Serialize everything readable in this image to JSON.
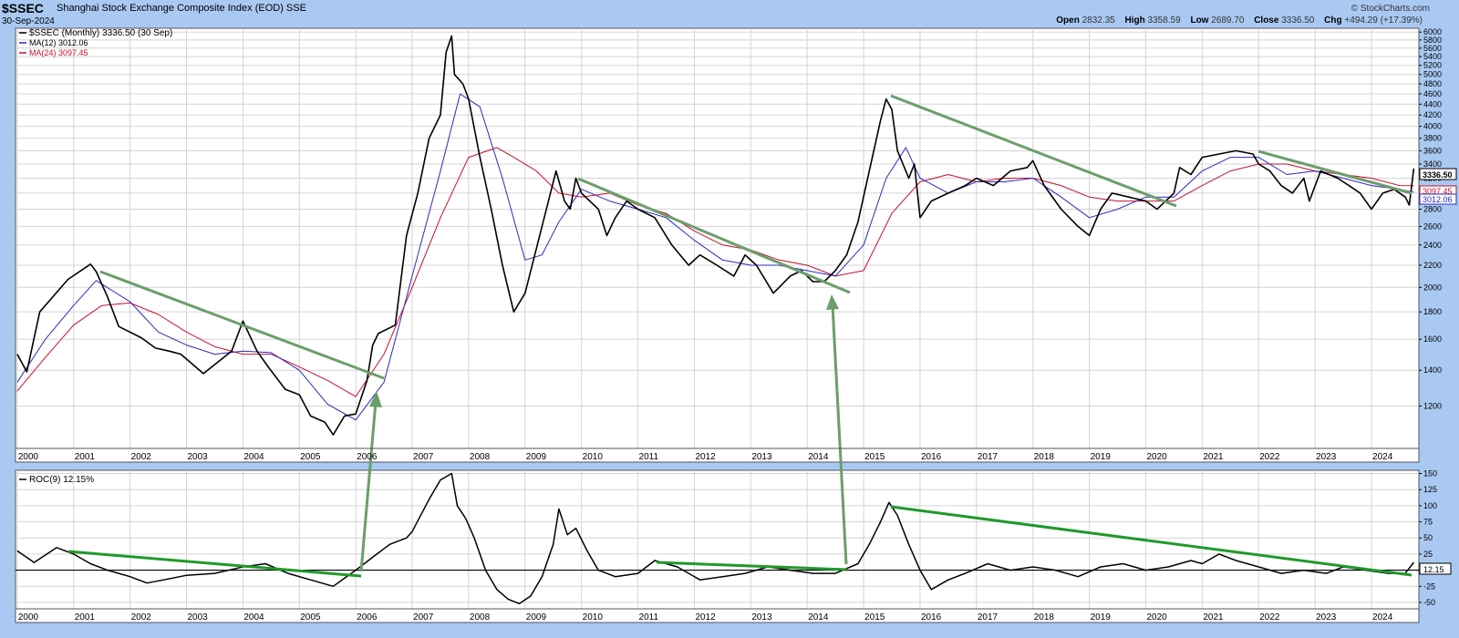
{
  "header": {
    "symbol": "$SSEC",
    "name": "Shanghai Stock Exchange Composite Index (EOD)  SSE",
    "date": "30-Sep-2024",
    "copyright": "© StockCharts.com",
    "open_label": "Open",
    "open_value": "2832.35",
    "high_label": "High",
    "high_value": "3358.59",
    "low_label": "Low",
    "low_value": "2689.70",
    "close_label": "Close",
    "close_value": "3336.50",
    "chg_label": "Chg",
    "chg_value": "+494.29 (+17.39%)"
  },
  "legend": {
    "price": "$SSEC (Monthly) 3336.50 (30 Sep)",
    "ma12": "MA(12) 3012.06",
    "ma24": "MA(24) 3097.45",
    "roc": "ROC(9) 12.15%"
  },
  "price_tags": {
    "close": "3336.50",
    "ma24": "3097.45",
    "ma12": "3012.06",
    "roc": "12.15"
  },
  "colors": {
    "price": "#000000",
    "ma12": "#2b2bbd",
    "ma24": "#c8102e",
    "trendline": "#5d9a5d",
    "roc_trendline": "#1f9a2a",
    "background": "#a9c9f2",
    "panel": "#ffffff"
  },
  "chart_data": [
    {
      "type": "line",
      "title": "$SSEC",
      "yscale": "log",
      "ylim": [
        1000,
        6100
      ],
      "yticks": [
        1200,
        1400,
        1600,
        1800,
        2000,
        2200,
        2400,
        2600,
        2800,
        3000,
        3200,
        3400,
        3600,
        3800,
        4000,
        4200,
        4400,
        4600,
        4800,
        5000,
        5200,
        5400,
        5600,
        5800,
        6000
      ],
      "xlim": [
        1999.97,
        2024.84
      ],
      "xticks": [
        "2000",
        "2001",
        "2002",
        "2003",
        "2004",
        "2005",
        "2006",
        "2007",
        "2008",
        "2009",
        "2010",
        "2011",
        "2012",
        "2013",
        "2014",
        "2015",
        "2016",
        "2017",
        "2018",
        "2019",
        "2020",
        "2021",
        "2022",
        "2023",
        "2024"
      ],
      "grid": true,
      "series": [
        {
          "name": "$SSEC (Monthly)",
          "x": [
            2000.0,
            2000.17,
            2000.4,
            2000.9,
            2001.3,
            2001.4,
            2001.6,
            2001.8,
            2002.2,
            2002.45,
            2002.7,
            2002.9,
            2003.3,
            2003.8,
            2004.0,
            2004.25,
            2004.45,
            2004.75,
            2005.0,
            2005.2,
            2005.45,
            2005.6,
            2005.8,
            2006.0,
            2006.2,
            2006.3,
            2006.4,
            2006.7,
            2006.9,
            2007.1,
            2007.3,
            2007.5,
            2007.6,
            2007.7,
            2007.75,
            2007.9,
            2008.0,
            2008.2,
            2008.4,
            2008.6,
            2008.8,
            2009.0,
            2009.3,
            2009.55,
            2009.7,
            2009.8,
            2009.9,
            2010.0,
            2010.3,
            2010.45,
            2010.6,
            2010.8,
            2011.0,
            2011.3,
            2011.6,
            2011.9,
            2012.1,
            2012.4,
            2012.7,
            2012.9,
            2013.1,
            2013.4,
            2013.7,
            2013.9,
            2014.1,
            2014.3,
            2014.5,
            2014.7,
            2014.9,
            2015.1,
            2015.3,
            2015.4,
            2015.5,
            2015.6,
            2015.8,
            2015.9,
            2016.0,
            2016.2,
            2016.5,
            2016.8,
            2017.0,
            2017.3,
            2017.6,
            2017.9,
            2018.0,
            2018.2,
            2018.5,
            2018.8,
            2019.0,
            2019.2,
            2019.4,
            2019.7,
            2020.0,
            2020.2,
            2020.5,
            2020.6,
            2020.8,
            2021.0,
            2021.3,
            2021.6,
            2021.9,
            2022.0,
            2022.2,
            2022.4,
            2022.6,
            2022.8,
            2022.9,
            2023.1,
            2023.4,
            2023.6,
            2023.8,
            2024.0,
            2024.2,
            2024.4,
            2024.6,
            2024.67,
            2024.75
          ],
          "values": [
            1500,
            1390,
            1800,
            2070,
            2210,
            2140,
            1920,
            1690,
            1610,
            1540,
            1520,
            1500,
            1380,
            1520,
            1730,
            1520,
            1420,
            1290,
            1260,
            1150,
            1120,
            1060,
            1150,
            1160,
            1340,
            1560,
            1640,
            1700,
            2500,
            3000,
            3800,
            4200,
            5500,
            5900,
            5000,
            4800,
            4500,
            3500,
            2800,
            2200,
            1800,
            1950,
            2600,
            3300,
            2900,
            2800,
            3200,
            3000,
            2800,
            2500,
            2700,
            2900,
            2800,
            2700,
            2400,
            2200,
            2300,
            2200,
            2100,
            2300,
            2200,
            1950,
            2100,
            2150,
            2050,
            2050,
            2150,
            2300,
            2650,
            3300,
            4100,
            4500,
            4300,
            3600,
            3200,
            3400,
            2700,
            2900,
            3000,
            3100,
            3200,
            3100,
            3300,
            3350,
            3450,
            3100,
            2800,
            2600,
            2500,
            2800,
            3000,
            2950,
            2900,
            2800,
            3000,
            3350,
            3250,
            3500,
            3550,
            3600,
            3550,
            3400,
            3300,
            3100,
            3000,
            3200,
            2900,
            3300,
            3200,
            3100,
            3000,
            2800,
            3000,
            3050,
            2950,
            2850,
            3336.5
          ]
        },
        {
          "name": "MA(12)",
          "x": [
            2000.0,
            2000.5,
            2001.0,
            2001.4,
            2002.0,
            2002.5,
            2003.0,
            2003.5,
            2004.0,
            2004.5,
            2005.0,
            2005.5,
            2006.0,
            2006.5,
            2007.0,
            2007.5,
            2007.85,
            2008.2,
            2008.6,
            2009.0,
            2009.3,
            2009.6,
            2010.0,
            2010.5,
            2011.0,
            2011.5,
            2012.0,
            2012.5,
            2013.0,
            2013.5,
            2014.0,
            2014.5,
            2015.0,
            2015.4,
            2015.75,
            2016.0,
            2016.5,
            2017.0,
            2017.5,
            2018.0,
            2018.5,
            2019.0,
            2019.5,
            2020.0,
            2020.5,
            2021.0,
            2021.5,
            2022.0,
            2022.5,
            2023.0,
            2023.5,
            2024.0,
            2024.5,
            2024.75
          ],
          "values": [
            1330,
            1600,
            1850,
            2060,
            1880,
            1650,
            1560,
            1500,
            1520,
            1510,
            1400,
            1210,
            1130,
            1330,
            2100,
            3300,
            4600,
            4350,
            3200,
            2250,
            2300,
            2650,
            3050,
            2900,
            2800,
            2700,
            2450,
            2250,
            2200,
            2200,
            2150,
            2100,
            2400,
            3200,
            3650,
            3200,
            3000,
            3150,
            3150,
            3200,
            2950,
            2700,
            2800,
            2950,
            2950,
            3300,
            3500,
            3500,
            3250,
            3300,
            3200,
            3100,
            3050,
            3012.06
          ]
        },
        {
          "name": "MA(24)",
          "x": [
            2000.0,
            2000.5,
            2001.0,
            2001.5,
            2002.0,
            2002.5,
            2003.0,
            2003.5,
            2004.0,
            2004.5,
            2005.0,
            2005.5,
            2006.0,
            2006.5,
            2007.0,
            2007.5,
            2008.0,
            2008.5,
            2008.8,
            2009.2,
            2009.6,
            2010.0,
            2010.5,
            2011.0,
            2011.5,
            2012.0,
            2012.5,
            2013.0,
            2013.5,
            2014.0,
            2014.5,
            2015.0,
            2015.5,
            2016.0,
            2016.5,
            2017.0,
            2017.5,
            2018.0,
            2018.5,
            2019.0,
            2019.5,
            2020.0,
            2020.5,
            2021.0,
            2021.5,
            2022.0,
            2022.5,
            2023.0,
            2023.5,
            2024.0,
            2024.5,
            2024.75
          ],
          "values": [
            1280,
            1480,
            1700,
            1850,
            1870,
            1780,
            1650,
            1550,
            1500,
            1500,
            1420,
            1340,
            1250,
            1500,
            2000,
            2700,
            3500,
            3650,
            3500,
            3300,
            3000,
            2950,
            3000,
            2850,
            2750,
            2550,
            2400,
            2350,
            2250,
            2200,
            2100,
            2150,
            2750,
            3150,
            3250,
            3150,
            3200,
            3200,
            3100,
            2950,
            2900,
            2900,
            2900,
            3100,
            3300,
            3400,
            3400,
            3300,
            3250,
            3200,
            3100,
            3097.45
          ]
        }
      ]
    },
    {
      "type": "line",
      "title": "ROC(9)",
      "ylim": [
        -60,
        155
      ],
      "yticks": [
        -50,
        -25,
        0,
        25,
        50,
        75,
        100,
        125,
        150
      ],
      "grid": true,
      "series": [
        {
          "name": "ROC(9)",
          "x": [
            2000.0,
            2000.3,
            2000.7,
            2001.0,
            2001.3,
            2001.6,
            2002.0,
            2002.3,
            2002.6,
            2003.0,
            2003.5,
            2004.0,
            2004.4,
            2004.8,
            2005.2,
            2005.6,
            2006.0,
            2006.3,
            2006.6,
            2006.9,
            2007.0,
            2007.3,
            2007.5,
            2007.7,
            2007.8,
            2007.95,
            2008.1,
            2008.3,
            2008.5,
            2008.7,
            2008.9,
            2009.1,
            2009.3,
            2009.5,
            2009.6,
            2009.75,
            2009.9,
            2010.1,
            2010.3,
            2010.6,
            2011.0,
            2011.3,
            2011.7,
            2012.1,
            2012.5,
            2012.9,
            2013.3,
            2013.7,
            2014.1,
            2014.5,
            2014.9,
            2015.1,
            2015.3,
            2015.45,
            2015.6,
            2015.8,
            2016.0,
            2016.2,
            2016.5,
            2016.8,
            2017.2,
            2017.6,
            2018.0,
            2018.4,
            2018.8,
            2019.2,
            2019.6,
            2020.0,
            2020.4,
            2020.8,
            2021.0,
            2021.3,
            2021.6,
            2022.0,
            2022.4,
            2022.8,
            2023.2,
            2023.5,
            2023.9,
            2024.3,
            2024.6,
            2024.75
          ],
          "values": [
            30,
            12,
            35,
            25,
            10,
            0,
            -10,
            -20,
            -15,
            -8,
            -5,
            5,
            10,
            -5,
            -15,
            -25,
            0,
            20,
            40,
            50,
            60,
            110,
            140,
            150,
            100,
            80,
            50,
            0,
            -30,
            -45,
            -52,
            -40,
            -10,
            40,
            95,
            55,
            65,
            30,
            0,
            -10,
            -5,
            15,
            5,
            -15,
            -10,
            -5,
            5,
            0,
            -5,
            -5,
            10,
            40,
            75,
            105,
            85,
            40,
            0,
            -30,
            -15,
            -5,
            10,
            0,
            5,
            0,
            -10,
            5,
            10,
            0,
            5,
            15,
            10,
            25,
            15,
            5,
            -5,
            0,
            -5,
            5,
            0,
            -5,
            -5,
            12.15
          ]
        }
      ]
    }
  ]
}
